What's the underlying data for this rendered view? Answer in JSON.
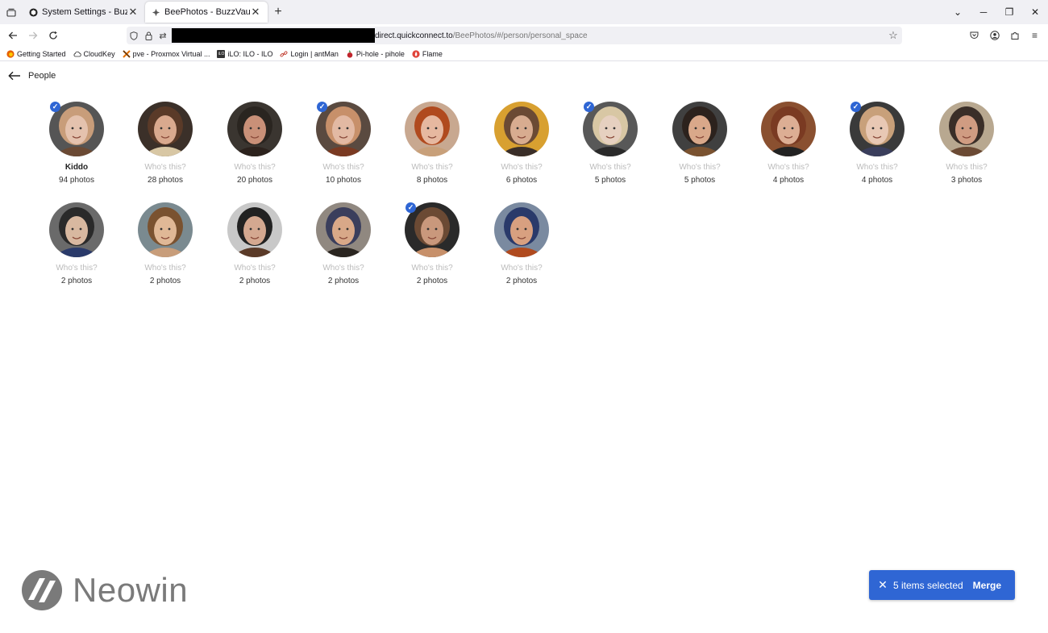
{
  "browser": {
    "tabs": [
      {
        "title": "System Settings - BuzzVault",
        "active": false
      },
      {
        "title": "BeePhotos - BuzzVault",
        "active": true
      }
    ],
    "url": {
      "host": "direct.quickconnect.to",
      "path": "/BeePhotos/#/person/personal_space"
    },
    "bookmarks": [
      {
        "label": "Getting Started",
        "icon": "firefox-icon"
      },
      {
        "label": "CloudKey",
        "icon": "cloud-icon"
      },
      {
        "label": "pve - Proxmox Virtual ...",
        "icon": "proxmox-icon"
      },
      {
        "label": "iLO: ILO - ILO",
        "icon": "ilo-icon"
      },
      {
        "label": "Login | antMan",
        "icon": "link-icon"
      },
      {
        "label": "Pi-hole - pihole",
        "icon": "pihole-icon"
      },
      {
        "label": "Flame",
        "icon": "flame-icon"
      }
    ]
  },
  "page": {
    "title": "People",
    "unnamed_label": "Who's this?",
    "people": [
      {
        "name": "Kiddo",
        "count": "94 photos",
        "selected": true
      },
      {
        "name": "",
        "count": "28 photos",
        "selected": false
      },
      {
        "name": "",
        "count": "20 photos",
        "selected": false
      },
      {
        "name": "",
        "count": "10 photos",
        "selected": true
      },
      {
        "name": "",
        "count": "8 photos",
        "selected": false
      },
      {
        "name": "",
        "count": "6 photos",
        "selected": false
      },
      {
        "name": "",
        "count": "5 photos",
        "selected": true
      },
      {
        "name": "",
        "count": "5 photos",
        "selected": false
      },
      {
        "name": "",
        "count": "4 photos",
        "selected": false
      },
      {
        "name": "",
        "count": "4 photos",
        "selected": true
      },
      {
        "name": "",
        "count": "3 photos",
        "selected": false
      },
      {
        "name": "",
        "count": "2 photos",
        "selected": false
      },
      {
        "name": "",
        "count": "2 photos",
        "selected": false
      },
      {
        "name": "",
        "count": "2 photos",
        "selected": false
      },
      {
        "name": "",
        "count": "2 photos",
        "selected": false
      },
      {
        "name": "",
        "count": "2 photos",
        "selected": true
      },
      {
        "name": "",
        "count": "2 photos",
        "selected": false
      }
    ]
  },
  "selection": {
    "count_text": "5 items selected",
    "merge_label": "Merge"
  },
  "watermark": {
    "text": "Neowin"
  },
  "colors": {
    "accent": "#2f66d4",
    "unnamed": "#bbbbbb"
  }
}
